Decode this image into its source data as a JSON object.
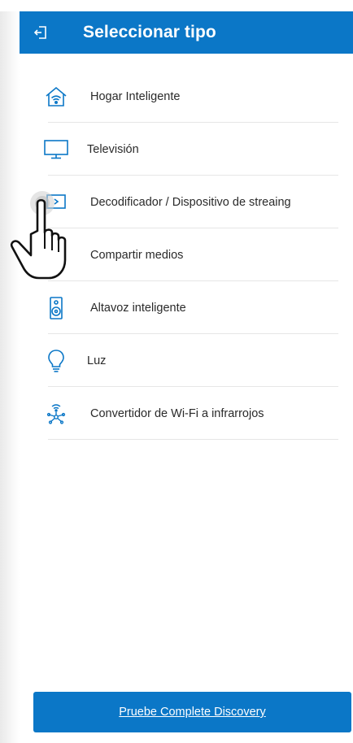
{
  "header": {
    "title": "Seleccionar tipo",
    "back_icon": "exit-icon",
    "color": "#0b77c7"
  },
  "items": [
    {
      "label": "Hogar Inteligente",
      "icon": "smart-home-icon"
    },
    {
      "label": "Televisión",
      "icon": "tv-icon"
    },
    {
      "label": "Decodificador / Dispositivo de streaing",
      "icon": "set-top-box-icon"
    },
    {
      "label": "Compartir medios",
      "icon": "media-share-icon"
    },
    {
      "label": "Altavoz inteligente",
      "icon": "speaker-icon"
    },
    {
      "label": "Luz",
      "icon": "bulb-icon"
    },
    {
      "label": "Convertidor de Wi-Fi a infrarrojos",
      "icon": "wifi-ir-icon"
    }
  ],
  "cta": {
    "label": "Pruebe Complete Discovery",
    "color": "#0b77c7"
  },
  "overlay": {
    "icon": "hand-pointer-icon"
  }
}
